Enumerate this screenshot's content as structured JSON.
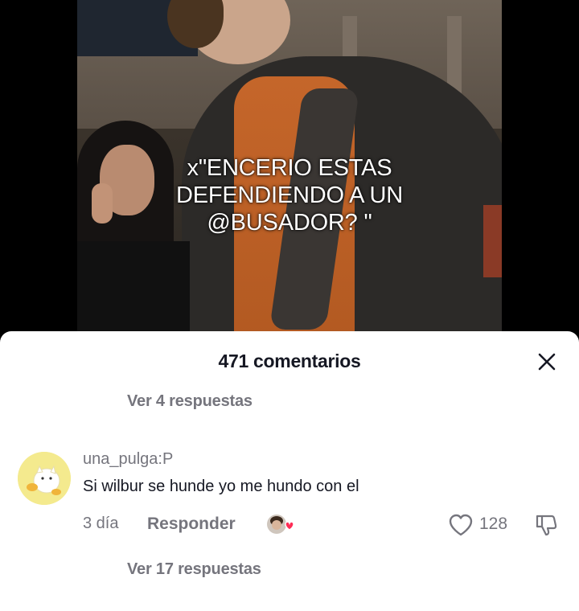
{
  "video": {
    "caption": "x\"ENCERIO ESTAS\nDEFENDIENDO A UN\n@BUSADOR? \""
  },
  "comments_sheet": {
    "title": "471 comentarios",
    "close_icon": "close-icon",
    "view_replies_top": "Ver 4 respuestas",
    "comment": {
      "username": "una_pulga:P",
      "text": "Si wilbur se hunde yo me hundo con el",
      "time": "3 día",
      "reply_label": "Responder",
      "likes": "128"
    },
    "view_replies_bottom": "Ver 17 respuestas"
  },
  "colors": {
    "text_primary": "#161823",
    "text_secondary": "#75757d",
    "heart_accent": "#fe2c55"
  }
}
